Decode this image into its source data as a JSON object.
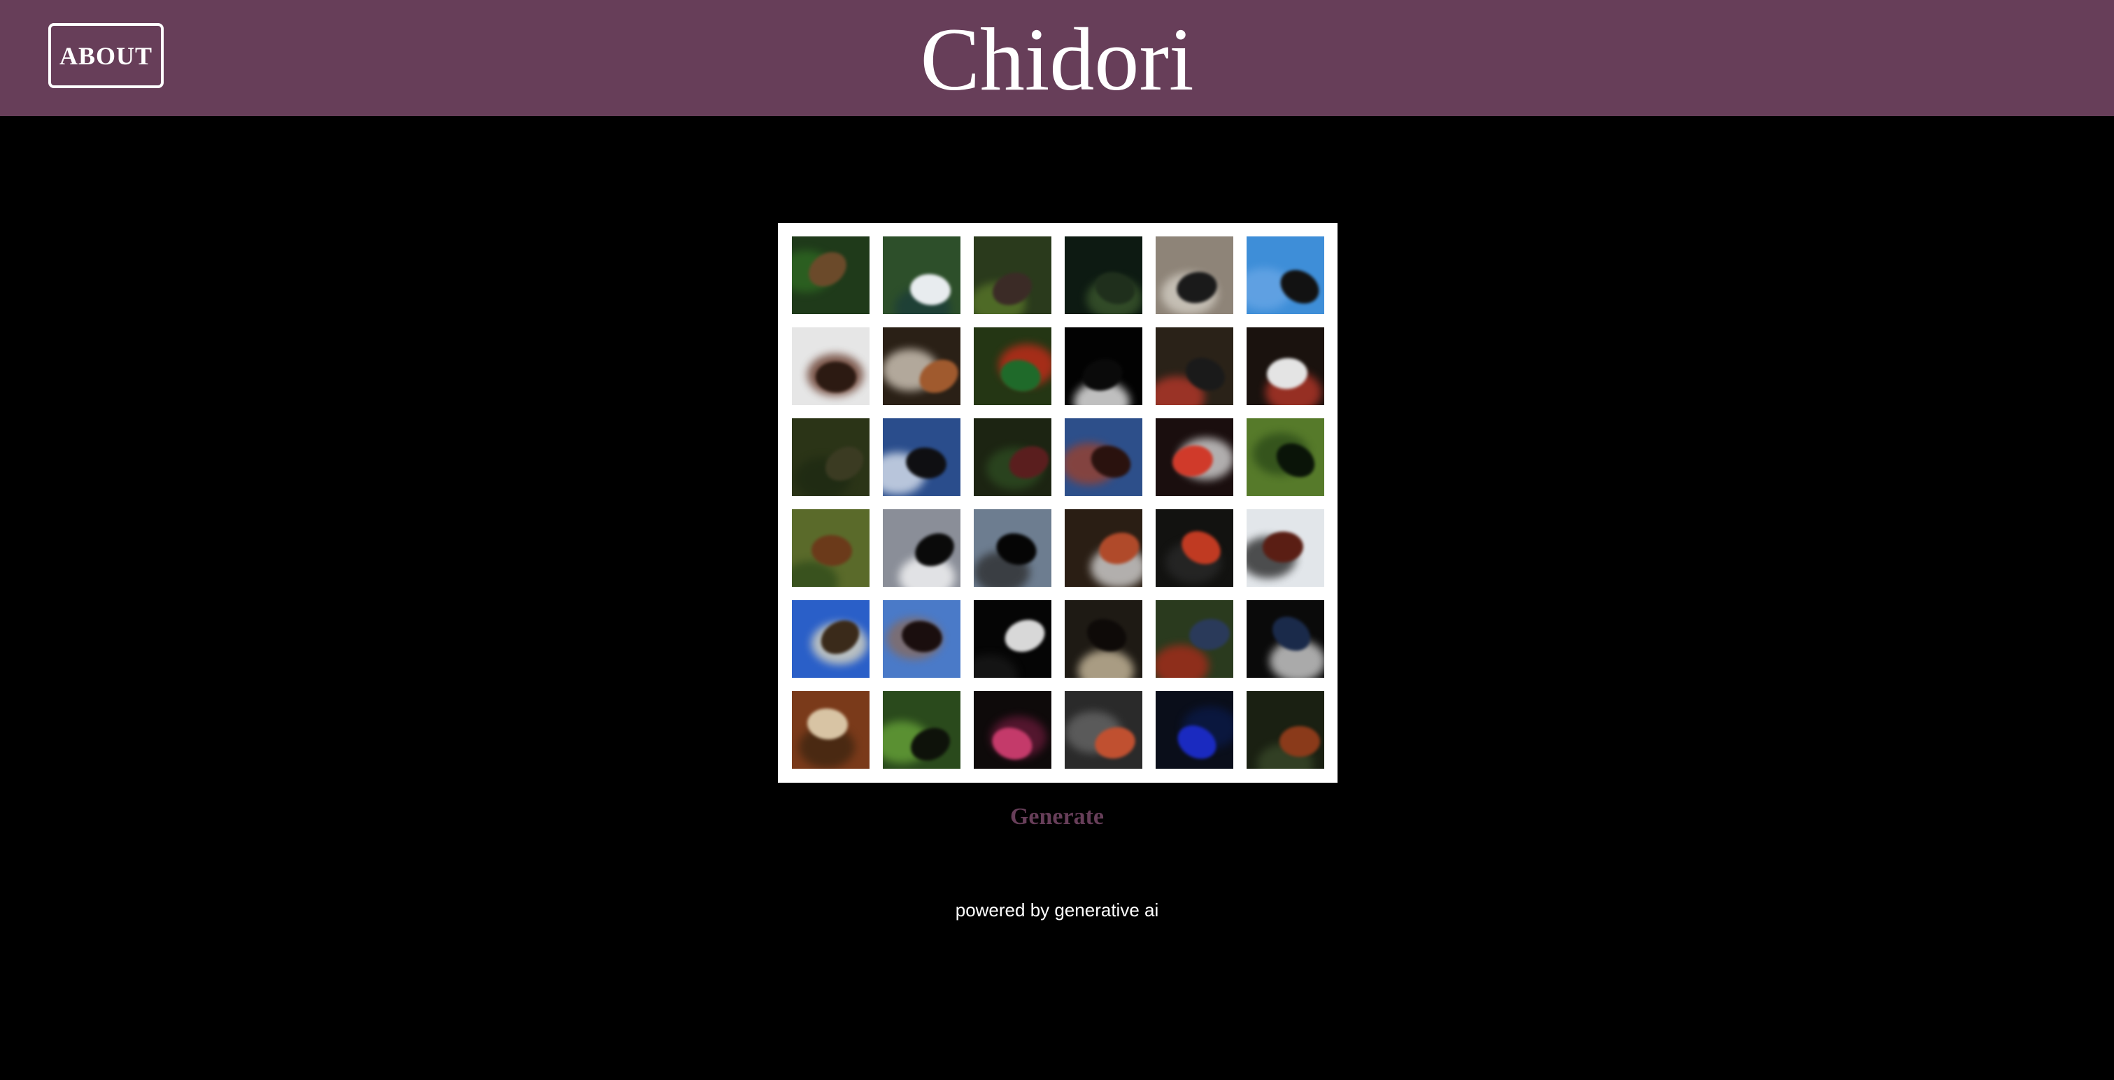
{
  "header": {
    "about_label": "ABOUT",
    "title": "Chidori",
    "background_color": "#673e59"
  },
  "gallery": {
    "rows": 6,
    "cols": 6,
    "frame_color": "#ffffff",
    "tiles": [
      {
        "bg": "#1f3a1a",
        "bird": "#6b4a2a",
        "accent": "#2f6b22"
      },
      {
        "bg": "#2d4f2a",
        "bird": "#e8ecef",
        "accent": "#1a3b3a"
      },
      {
        "bg": "#2a3a1c",
        "bird": "#3b2b26",
        "accent": "#5b7a2a"
      },
      {
        "bg": "#0d1a12",
        "bird": "#1f2f1c",
        "accent": "#3d5a2e"
      },
      {
        "bg": "#8e8478",
        "bird": "#1a1a1a",
        "accent": "#d7d2c8"
      },
      {
        "bg": "#3e8ed8",
        "bird": "#121212",
        "accent": "#6aa7e6"
      },
      {
        "bg": "#e6e6e6",
        "bird": "#2c1a12",
        "accent": "#5a2a1a"
      },
      {
        "bg": "#2a2016",
        "bird": "#a05a2e",
        "accent": "#e0d6c8"
      },
      {
        "bg": "#243614",
        "bird": "#1f6a2a",
        "accent": "#d02a1a"
      },
      {
        "bg": "#020202",
        "bird": "#0a0a0a",
        "accent": "#ffffff"
      },
      {
        "bg": "#2a2218",
        "bird": "#1a1a1a",
        "accent": "#c0392b"
      },
      {
        "bg": "#1a120e",
        "bird": "#e4e4e4",
        "accent": "#c0392b"
      },
      {
        "bg": "#2b3417",
        "bird": "#3b3b22",
        "accent": "#1d2912"
      },
      {
        "bg": "#2a4d8c",
        "bird": "#0f0f12",
        "accent": "#e8eef6"
      },
      {
        "bg": "#1c2412",
        "bird": "#5a1e1e",
        "accent": "#2e4d22"
      },
      {
        "bg": "#2d4f8a",
        "bird": "#2a120e",
        "accent": "#a04028"
      },
      {
        "bg": "#1a0e0e",
        "bird": "#d03a2a",
        "accent": "#e4e4e4"
      },
      {
        "bg": "#567a2a",
        "bird": "#0a1408",
        "accent": "#2a4818"
      },
      {
        "bg": "#5a6a2a",
        "bird": "#6b3a1a",
        "accent": "#2e4a1a"
      },
      {
        "bg": "#8a8e98",
        "bird": "#0a0a0a",
        "accent": "#ffffff"
      },
      {
        "bg": "#6d7d90",
        "bird": "#050505",
        "accent": "#2a2a2a"
      },
      {
        "bg": "#2a1e14",
        "bird": "#b04a2a",
        "accent": "#e0e0e0"
      },
      {
        "bg": "#121210",
        "bird": "#c03a22",
        "accent": "#2a2a2a"
      },
      {
        "bg": "#e2e6ea",
        "bird": "#5a1e14",
        "accent": "#1a1a1a"
      },
      {
        "bg": "#2a5fc8",
        "bird": "#3a2a1a",
        "accent": "#e8e0c0"
      },
      {
        "bg": "#4a7ac8",
        "bird": "#1a0e0e",
        "accent": "#8a6a5a"
      },
      {
        "bg": "#050505",
        "bird": "#d8d8d8",
        "accent": "#1a1a1a"
      },
      {
        "bg": "#1e1a14",
        "bird": "#0e0a08",
        "accent": "#d8c8a8"
      },
      {
        "bg": "#2a3a1e",
        "bird": "#2a3a5a",
        "accent": "#b02a1a"
      },
      {
        "bg": "#0a0a0a",
        "bird": "#1a2a4a",
        "accent": "#e0e0e0"
      },
      {
        "bg": "#7a3a1a",
        "bird": "#d8c4a4",
        "accent": "#3a2410"
      },
      {
        "bg": "#2a4a1c",
        "bird": "#0e120a",
        "accent": "#6aa83a"
      },
      {
        "bg": "#0e0a0a",
        "bird": "#c43a6a",
        "accent": "#6a1a3a"
      },
      {
        "bg": "#2a2a2a",
        "bird": "#c05030",
        "accent": "#6a6a6a"
      },
      {
        "bg": "#0a0e1a",
        "bird": "#1a2ac0",
        "accent": "#0a1a4a"
      },
      {
        "bg": "#1a2012",
        "bird": "#8a3a1a",
        "accent": "#3a4a2a"
      }
    ]
  },
  "actions": {
    "generate_label": "Generate",
    "generate_color": "#673e59"
  },
  "footer": {
    "text": "powered by generative ai"
  }
}
